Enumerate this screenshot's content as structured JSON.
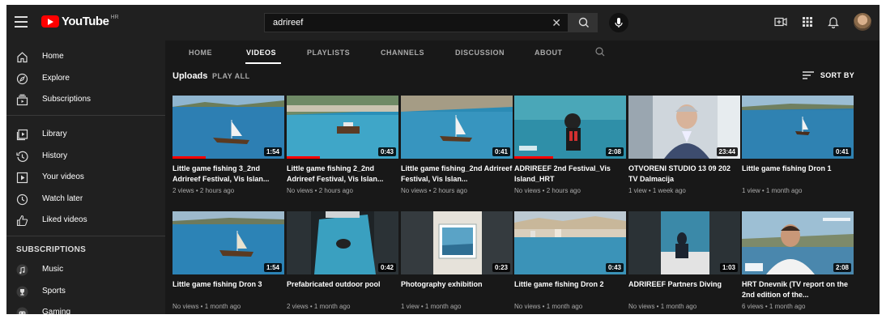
{
  "header": {
    "logo_text": "YouTube",
    "logo_region": "HR",
    "search_value": "adrireef",
    "icons": [
      "menu-icon",
      "search-icon",
      "mic-icon",
      "create-video-icon",
      "apps-icon",
      "bell-icon",
      "avatar"
    ]
  },
  "sidebar": {
    "items": [
      {
        "label": "Home",
        "icon": "home-icon"
      },
      {
        "label": "Explore",
        "icon": "compass-icon"
      },
      {
        "label": "Subscriptions",
        "icon": "subscriptions-icon"
      },
      {
        "label": "Library",
        "icon": "library-icon"
      },
      {
        "label": "History",
        "icon": "history-icon"
      },
      {
        "label": "Your videos",
        "icon": "play-square-icon"
      },
      {
        "label": "Watch later",
        "icon": "clock-icon"
      },
      {
        "label": "Liked videos",
        "icon": "thumb-up-icon"
      }
    ],
    "subscriptions_heading": "SUBSCRIPTIONS",
    "subscriptions": [
      {
        "label": "Music",
        "icon": "music-icon"
      },
      {
        "label": "Sports",
        "icon": "trophy-icon"
      },
      {
        "label": "Gaming",
        "icon": "gamepad-icon"
      }
    ]
  },
  "channel_tabs": [
    "HOME",
    "VIDEOS",
    "PLAYLISTS",
    "CHANNELS",
    "DISCUSSION",
    "ABOUT"
  ],
  "active_tab": "VIDEOS",
  "uploads": {
    "label": "Uploads",
    "play_all": "PLAY ALL",
    "sort_by": "SORT BY"
  },
  "videos": [
    {
      "title": "Little game fishing 3_2nd Adrireef Festival, Vis Islan...",
      "meta": "2 views • 2 hours ago",
      "duration": "1:54",
      "watched": 0.3
    },
    {
      "title": "Little game fishing 2_2nd Adrireef Festival, Vis Islan...",
      "meta": "No views • 2 hours ago",
      "duration": "0:43",
      "watched": 0.3
    },
    {
      "title": "Little game fishing_2nd Adrireef Festival, Vis Islan...",
      "meta": "No views • 2 hours ago",
      "duration": "0:41",
      "watched": 0
    },
    {
      "title": "ADRIREEF 2nd Festival_Vis Island_HRT",
      "meta": "No views • 2 hours ago",
      "duration": "2:08",
      "watched": 0.35
    },
    {
      "title": "OTVORENI STUDIO 13 09 202 TV Dalmacija",
      "meta": "1 view • 1 week ago",
      "duration": "23:44",
      "watched": 0
    },
    {
      "title": "Little game fishing Dron 1",
      "meta": "1 view • 1 month ago",
      "duration": "0:41",
      "watched": 0
    },
    {
      "title": "Little game fishing Dron 3",
      "meta": "No views • 1 month ago",
      "duration": "1:54",
      "watched": 0
    },
    {
      "title": "Prefabricated outdoor pool",
      "meta": "2 views • 1 month ago",
      "duration": "0:42",
      "watched": 0
    },
    {
      "title": "Photography exhibition",
      "meta": "1 view • 1 month ago",
      "duration": "0:23",
      "watched": 0
    },
    {
      "title": "Little game fishing Dron 2",
      "meta": "No views • 1 month ago",
      "duration": "0:43",
      "watched": 0
    },
    {
      "title": "ADRIREEF Partners Diving",
      "meta": "No views • 1 month ago",
      "duration": "1:03",
      "watched": 0
    },
    {
      "title": "HRT Dnevnik (TV report on the 2nd edition of the...",
      "meta": "6 views • 1 month ago",
      "duration": "2:08",
      "watched": 0
    }
  ]
}
